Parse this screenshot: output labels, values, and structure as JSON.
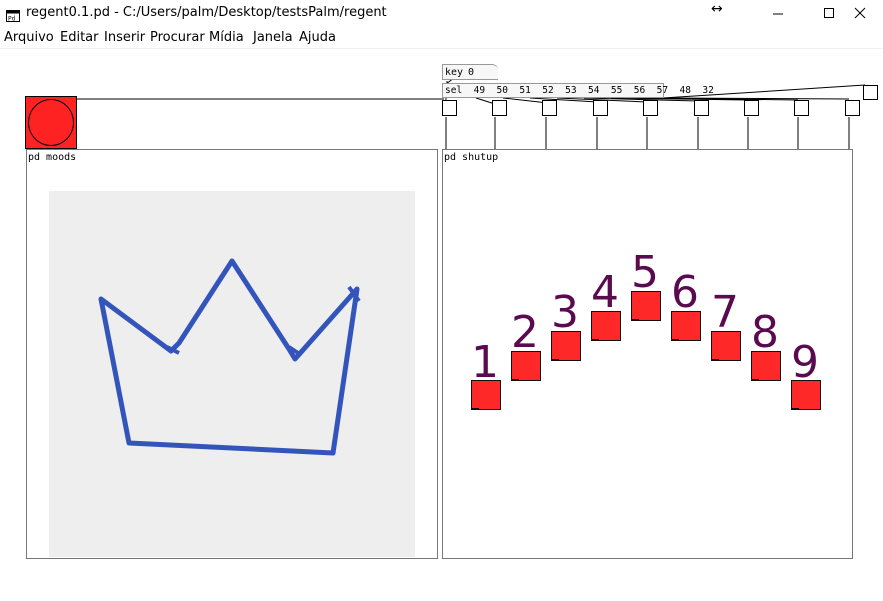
{
  "window": {
    "title": "regent0.1.pd  - C:/Users/palm/Desktop/testsPalm/regent",
    "resize_cursor": "↔"
  },
  "menu": {
    "items": [
      "Arquivo",
      "Editar",
      "Inserir",
      "Procurar",
      "Mídia",
      "Janela",
      "Ajuda"
    ]
  },
  "patch": {
    "key_object": "key",
    "key_value": "0",
    "sel_object": "sel  49  50  51  52  53  54  55  56  57  48  32",
    "moods_label": "pd moods",
    "shutup_label": "pd shutup",
    "bang_color": "#ff2222"
  },
  "shutup": {
    "keys": [
      {
        "label": "1",
        "color": "#ff2828"
      },
      {
        "label": "2",
        "color": "#ff2828"
      },
      {
        "label": "3",
        "color": "#ff2828"
      },
      {
        "label": "4",
        "color": "#ff2828"
      },
      {
        "label": "5",
        "color": "#ff2828"
      },
      {
        "label": "6",
        "color": "#ff2828"
      },
      {
        "label": "7",
        "color": "#ff2828"
      },
      {
        "label": "8",
        "color": "#ff2828"
      },
      {
        "label": "9",
        "color": "#ff2828"
      }
    ],
    "label_color": "#5a0a4e"
  },
  "moods": {
    "image": "crown-drawing",
    "ink_color": "#3355bb"
  }
}
